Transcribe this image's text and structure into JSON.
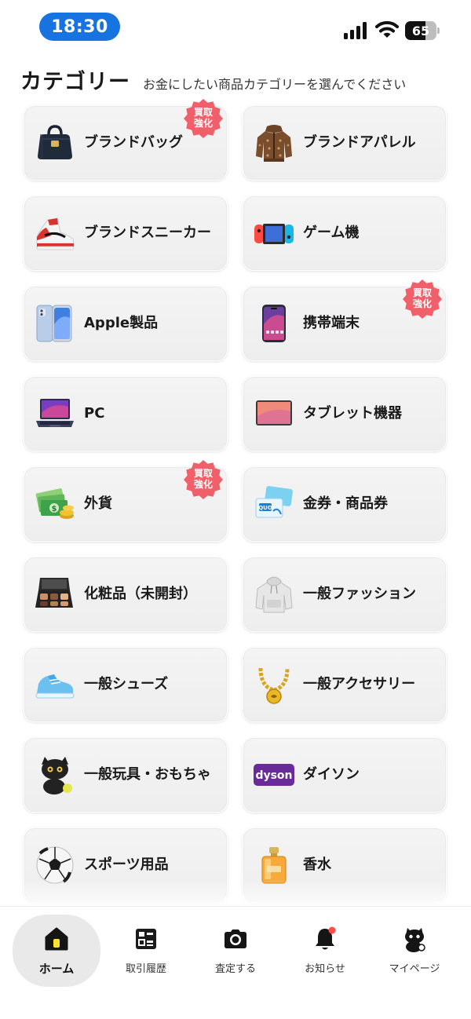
{
  "status_bar": {
    "time": "18:30",
    "battery": "65",
    "battery_level": 0.65
  },
  "header": {
    "title": "カテゴリー",
    "subtitle": "お金にしたい商品カテゴリーを選んでください"
  },
  "badge_text": "買取強化",
  "categories": [
    {
      "label": "ブランドバッグ",
      "icon": "handbag-icon",
      "badge": true
    },
    {
      "label": "ブランドアパレル",
      "icon": "jacket-icon",
      "badge": false
    },
    {
      "label": "ブランドスニーカー",
      "icon": "sneaker-icon",
      "badge": false
    },
    {
      "label": "ゲーム機",
      "icon": "game-console-icon",
      "badge": false
    },
    {
      "label": "Apple製品",
      "icon": "iphone-icon",
      "badge": false
    },
    {
      "label": "携帯端末",
      "icon": "smartphone-icon",
      "badge": true
    },
    {
      "label": "PC",
      "icon": "laptop-icon",
      "badge": false
    },
    {
      "label": "タブレット機器",
      "icon": "tablet-icon",
      "badge": false
    },
    {
      "label": "外貨",
      "icon": "cash-icon",
      "badge": true
    },
    {
      "label": "金券・商品券",
      "icon": "gift-card-icon",
      "badge": false
    },
    {
      "label": "化粧品（未開封）",
      "icon": "makeup-palette-icon",
      "badge": false
    },
    {
      "label": "一般ファッション",
      "icon": "hoodie-icon",
      "badge": false
    },
    {
      "label": "一般シューズ",
      "icon": "shoe-icon",
      "badge": false
    },
    {
      "label": "一般アクセサリー",
      "icon": "necklace-icon",
      "badge": false
    },
    {
      "label": "一般玩具・おもちゃ",
      "icon": "cat-toy-icon",
      "badge": false
    },
    {
      "label": "ダイソン",
      "icon": "dyson-logo-icon",
      "badge": false,
      "logo_text": "dyson"
    },
    {
      "label": "スポーツ用品",
      "icon": "soccer-ball-icon",
      "badge": false
    },
    {
      "label": "香水",
      "icon": "perfume-icon",
      "badge": false
    }
  ],
  "nav": [
    {
      "label": "ホーム",
      "icon": "home-icon",
      "active": true
    },
    {
      "label": "取引履歴",
      "icon": "history-icon",
      "active": false
    },
    {
      "label": "査定する",
      "icon": "camera-icon",
      "active": false
    },
    {
      "label": "お知らせ",
      "icon": "bell-icon",
      "active": false,
      "dot": true
    },
    {
      "label": "マイページ",
      "icon": "cat-avatar-icon",
      "active": false
    }
  ],
  "colors": {
    "time_pill": "#1673e0",
    "badge": "#f0606a",
    "home_icon": "#ffe033",
    "notify_dot": "#ff4d4d"
  }
}
